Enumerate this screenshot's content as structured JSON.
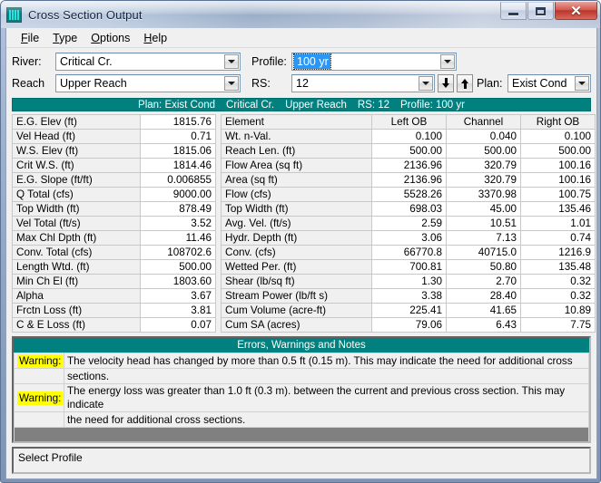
{
  "window": {
    "title": "Cross Section Output",
    "icon": "grid-icon",
    "buttons": {
      "minimize": "minimize",
      "maximize": "maximize",
      "close": "✕"
    }
  },
  "menu": [
    {
      "label": "File",
      "accel": "F"
    },
    {
      "label": "Type",
      "accel": "T"
    },
    {
      "label": "Options",
      "accel": "O"
    },
    {
      "label": "Help",
      "accel": "H"
    }
  ],
  "selectors": {
    "river_label": "River:",
    "river_value": "Critical Cr.",
    "reach_label": "Reach",
    "reach_value": "Upper Reach",
    "profile_label": "Profile:",
    "profile_value": "100 yr",
    "rs_label": "RS:",
    "rs_value": "12",
    "plan_label": "Plan:",
    "plan_value": "Exist Cond",
    "prev_button": "down-arrow",
    "next_button": "up-arrow"
  },
  "context_bar": {
    "plan": "Plan: Exist Cond",
    "river": "Critical Cr.",
    "reach": "Upper Reach",
    "rs": "RS: 12",
    "profile": "Profile: 100 yr"
  },
  "summary_table": {
    "rows": [
      {
        "label": "E.G. Elev (ft)",
        "value": "1815.76"
      },
      {
        "label": "Vel Head (ft)",
        "value": "0.71"
      },
      {
        "label": "W.S. Elev (ft)",
        "value": "1815.06"
      },
      {
        "label": "Crit W.S. (ft)",
        "value": "1814.46"
      },
      {
        "label": "E.G. Slope (ft/ft)",
        "value": "0.006855"
      },
      {
        "label": "Q Total (cfs)",
        "value": "9000.00"
      },
      {
        "label": "Top Width (ft)",
        "value": "878.49"
      },
      {
        "label": "Vel Total (ft/s)",
        "value": "3.52"
      },
      {
        "label": "Max Chl Dpth (ft)",
        "value": "11.46"
      },
      {
        "label": "Conv. Total (cfs)",
        "value": "108702.6"
      },
      {
        "label": "Length Wtd. (ft)",
        "value": "500.00"
      },
      {
        "label": "Min Ch El (ft)",
        "value": "1803.60"
      },
      {
        "label": "Alpha",
        "value": "3.67"
      },
      {
        "label": "Frctn Loss (ft)",
        "value": "3.81"
      },
      {
        "label": "C & E Loss (ft)",
        "value": "0.07"
      }
    ]
  },
  "element_table": {
    "headers": [
      "Element",
      "Left OB",
      "Channel",
      "Right OB"
    ],
    "rows": [
      {
        "label": "Wt. n-Val.",
        "left": "0.100",
        "channel": "0.040",
        "right": "0.100"
      },
      {
        "label": "Reach Len. (ft)",
        "left": "500.00",
        "channel": "500.00",
        "right": "500.00"
      },
      {
        "label": "Flow Area (sq ft)",
        "left": "2136.96",
        "channel": "320.79",
        "right": "100.16"
      },
      {
        "label": "Area (sq ft)",
        "left": "2136.96",
        "channel": "320.79",
        "right": "100.16"
      },
      {
        "label": "Flow (cfs)",
        "left": "5528.26",
        "channel": "3370.98",
        "right": "100.75"
      },
      {
        "label": "Top Width (ft)",
        "left": "698.03",
        "channel": "45.00",
        "right": "135.46"
      },
      {
        "label": "Avg. Vel. (ft/s)",
        "left": "2.59",
        "channel": "10.51",
        "right": "1.01"
      },
      {
        "label": "Hydr. Depth (ft)",
        "left": "3.06",
        "channel": "7.13",
        "right": "0.74"
      },
      {
        "label": "Conv. (cfs)",
        "left": "66770.8",
        "channel": "40715.0",
        "right": "1216.9"
      },
      {
        "label": "Wetted Per. (ft)",
        "left": "700.81",
        "channel": "50.80",
        "right": "135.48"
      },
      {
        "label": "Shear (lb/sq ft)",
        "left": "1.30",
        "channel": "2.70",
        "right": "0.32"
      },
      {
        "label": "Stream Power (lb/ft s)",
        "left": "3.38",
        "channel": "28.40",
        "right": "0.32"
      },
      {
        "label": "Cum Volume (acre-ft)",
        "left": "225.41",
        "channel": "41.65",
        "right": "10.89"
      },
      {
        "label": "Cum SA (acres)",
        "left": "79.06",
        "channel": "6.43",
        "right": "7.75"
      }
    ]
  },
  "notes_panel": {
    "title": "Errors, Warnings and Notes",
    "entries": [
      {
        "tag": "Warning:",
        "line1": "The velocity head has changed by more than 0.5 ft (0.15 m).  This may indicate the need for additional cross",
        "line2": "sections."
      },
      {
        "tag": "Warning:",
        "line1": "The energy loss was greater than 1.0 ft (0.3 m). between the current and previous cross section.  This may indicate",
        "line2": "the need for additional cross sections."
      }
    ]
  },
  "status_bar": {
    "text": "Select Profile"
  },
  "colors": {
    "teal_header": "#00807e",
    "warning_highlight": "#ffff00",
    "selection_blue": "#2a97f7",
    "filler_gray": "#808080"
  }
}
